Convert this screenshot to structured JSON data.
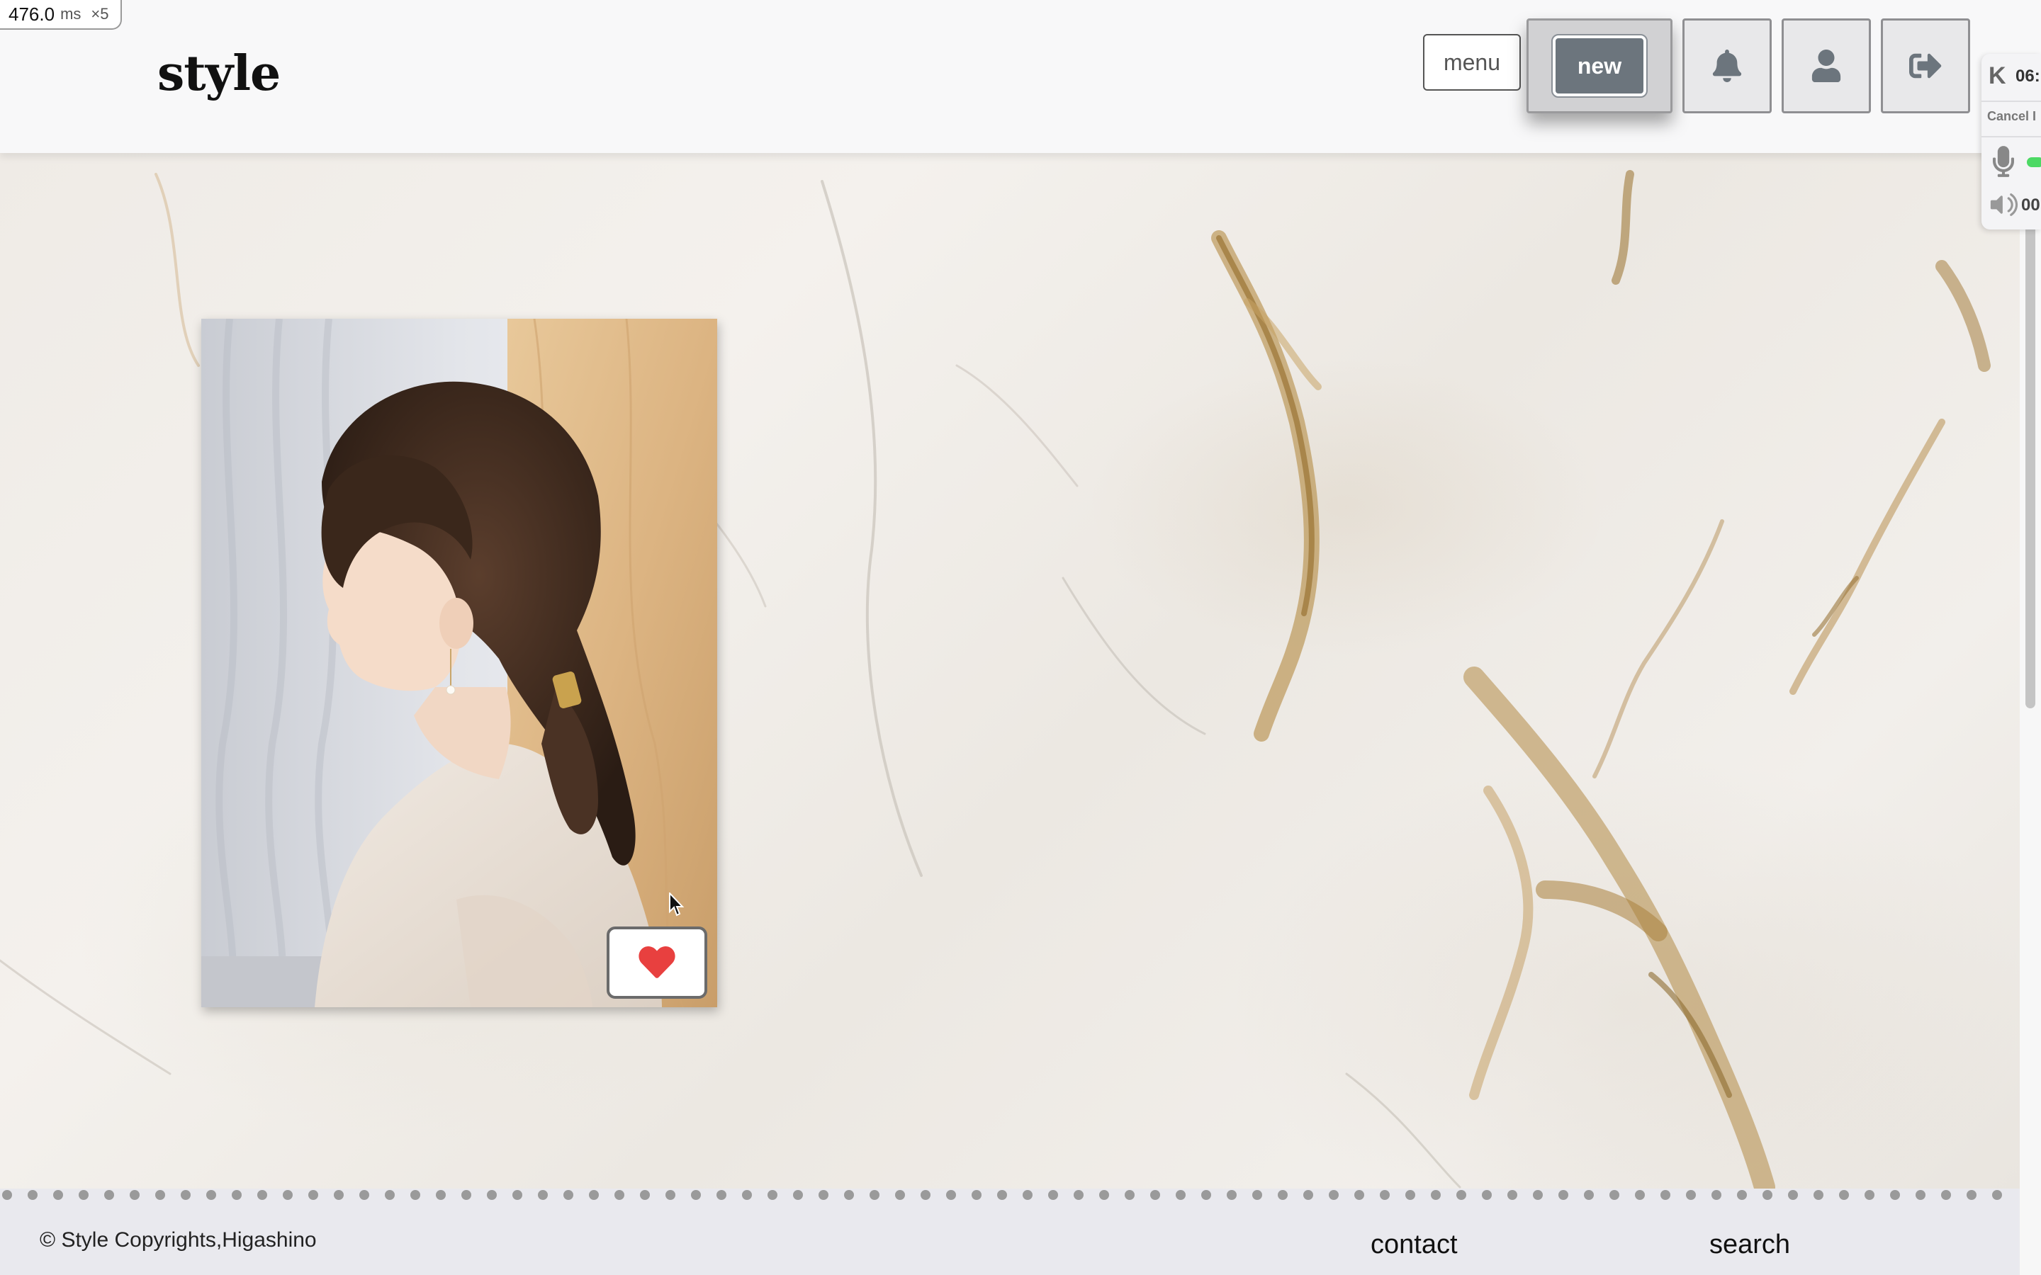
{
  "perf_badge": {
    "value": "476.0",
    "unit": "ms",
    "multiplier": "×5"
  },
  "header": {
    "logo": "style",
    "menu_label": "menu",
    "new_label": "new",
    "icons": [
      "bell-icon",
      "user-icon",
      "sign-out-icon"
    ]
  },
  "widget": {
    "time_prefix": "06:",
    "cancel_label": "Cancel I",
    "timer_prefix": "00"
  },
  "card": {
    "like_icon": "heart-icon",
    "like_color": "#e8403f"
  },
  "footer": {
    "copyright": "© Style Copyrights,Higashino",
    "links": [
      "contact",
      "search"
    ]
  },
  "colors": {
    "header_bg": "#f8f8f9",
    "new_button": "#6c757d",
    "icon_gray": "#6c757d",
    "footer_bg": "#e9e9ee",
    "marble_vein": "#b8924e"
  }
}
